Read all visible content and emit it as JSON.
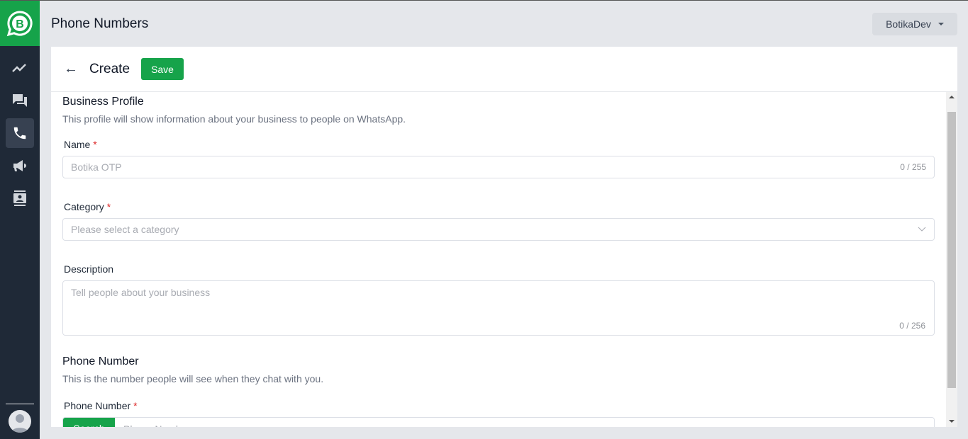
{
  "header": {
    "title": "Phone Numbers",
    "account": "BotikaDev"
  },
  "sidebar": {
    "items": [
      {
        "icon": "chart-line-icon"
      },
      {
        "icon": "chat-icon"
      },
      {
        "icon": "phone-icon",
        "active": true
      },
      {
        "icon": "megaphone-icon"
      },
      {
        "icon": "contacts-icon"
      }
    ]
  },
  "toolbar": {
    "title": "Create",
    "save_label": "Save"
  },
  "business": {
    "title": "Business Profile",
    "subtitle": "This profile will show information about your business to people on WhatsApp.",
    "name_label": "Name",
    "name_placeholder": "Botika OTP",
    "name_count": "0 / 255",
    "category_label": "Category",
    "category_placeholder": "Please select a category",
    "description_label": "Description",
    "description_placeholder": "Tell people about your business",
    "description_count": "0 / 256"
  },
  "phone": {
    "title": "Phone Number",
    "subtitle": "This is the number people will see when they chat with you.",
    "label": "Phone Number",
    "search_label": "Search",
    "placeholder": "Phone Number"
  },
  "required_mark": "*",
  "colors": {
    "brand": "#16a34a",
    "sidebar": "#1f2937"
  }
}
